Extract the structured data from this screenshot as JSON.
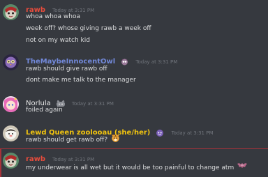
{
  "messages": [
    {
      "username": "rawb",
      "username_color": "#e74c3c",
      "timestamp": "Today at 3:31 PM",
      "lines": [
        "whoa whoa whoa",
        "week off? whose giving rawb a week off",
        "not on my watch kid"
      ]
    },
    {
      "username": "TheMaybeInnocentOwl",
      "username_color": "#7289da",
      "badge_icon": "owl-badge-icon",
      "timestamp": "Today at 3:31 PM",
      "lines": [
        "rawb should give rawb off",
        "dont make me talk to the manager"
      ]
    },
    {
      "username": "Norlula",
      "username_color": "#e9e9e9",
      "badge_icon": "badge-icon",
      "timestamp": "Today at 3:31 PM",
      "lines": [
        "foiled again"
      ]
    },
    {
      "username": "Lewd Queen zoolooau (she/her)",
      "username_color": "#f1c40f",
      "badge_icon": "badge-icon",
      "timestamp": "Today at 3:31 PM",
      "lines": [
        "rawb should get rawb off?"
      ],
      "emoji": "tiger-emoji-icon"
    },
    {
      "username": "rawb",
      "username_color": "#e74c3c",
      "timestamp": "Today at 3:31 PM",
      "lines": [
        "my underwear is all wet but it would be too painful to change atm"
      ],
      "emoji": "bat-emoji-icon"
    }
  ],
  "colors": {
    "background": "#36393f",
    "text": "#dcddde",
    "timestamp": "#72767d",
    "divider": "#a8323a"
  }
}
